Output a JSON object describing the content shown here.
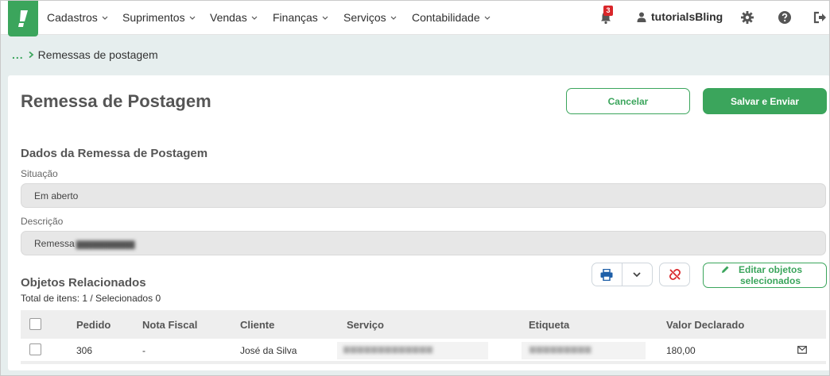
{
  "nav": {
    "items": [
      {
        "label": "Cadastros"
      },
      {
        "label": "Suprimentos"
      },
      {
        "label": "Vendas"
      },
      {
        "label": "Finanças"
      },
      {
        "label": "Serviços"
      },
      {
        "label": "Contabilidade"
      }
    ],
    "notification_count": "3",
    "username": "tutorialsBling"
  },
  "breadcrumb": {
    "dots": "...",
    "current": "Remessas de postagem"
  },
  "page": {
    "title": "Remessa de Postagem",
    "cancel_label": "Cancelar",
    "save_label": "Salvar e Enviar"
  },
  "form": {
    "section_title": "Dados da Remessa de Postagem",
    "situacao_label": "Situação",
    "situacao_value": "Em aberto",
    "descricao_label": "Descrição",
    "descricao_value": "Remessa"
  },
  "objects": {
    "section_title": "Objetos Relacionados",
    "total_text": "Total de itens: 1 / Selecionados 0",
    "edit_label": "Editar objetos selecionados",
    "columns": [
      "Pedido",
      "Nota Fiscal",
      "Cliente",
      "Serviço",
      "Etiqueta",
      "Valor Declarado"
    ],
    "rows": [
      {
        "pedido": "306",
        "nota_fiscal": "-",
        "cliente": "José da Silva",
        "valor": "180,00"
      }
    ]
  },
  "colors": {
    "accent": "#3ba55c",
    "badge": "#d9262a",
    "background": "#e6eeee"
  }
}
